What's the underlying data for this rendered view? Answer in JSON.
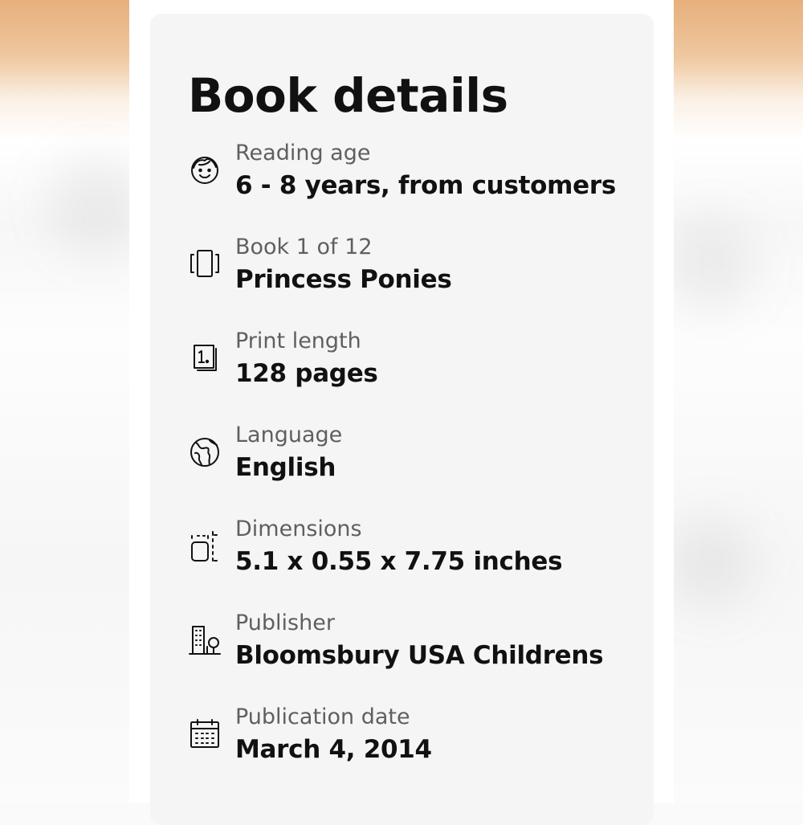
{
  "page": {
    "title": "Book details"
  },
  "details": [
    {
      "icon": "child-face-icon",
      "label": "Reading age",
      "value": "6 - 8 years, from customers"
    },
    {
      "icon": "book-series-icon",
      "label": "Book 1 of 12",
      "value": "Princess Ponies"
    },
    {
      "icon": "page-count-icon",
      "label": "Print length",
      "value": "128 pages"
    },
    {
      "icon": "globe-icon",
      "label": "Language",
      "value": "English"
    },
    {
      "icon": "dimensions-icon",
      "label": "Dimensions",
      "value": "5.1 x 0.55 x 7.75 inches"
    },
    {
      "icon": "building-icon",
      "label": "Publisher",
      "value": "Bloomsbury USA Childrens"
    },
    {
      "icon": "calendar-icon",
      "label": "Publication date",
      "value": "March 4, 2014"
    }
  ],
  "colors": {
    "card_background": "#f5f5f5",
    "label_text": "#5f5f5f",
    "value_text": "#111111",
    "top_accent": "#e6b07c"
  }
}
